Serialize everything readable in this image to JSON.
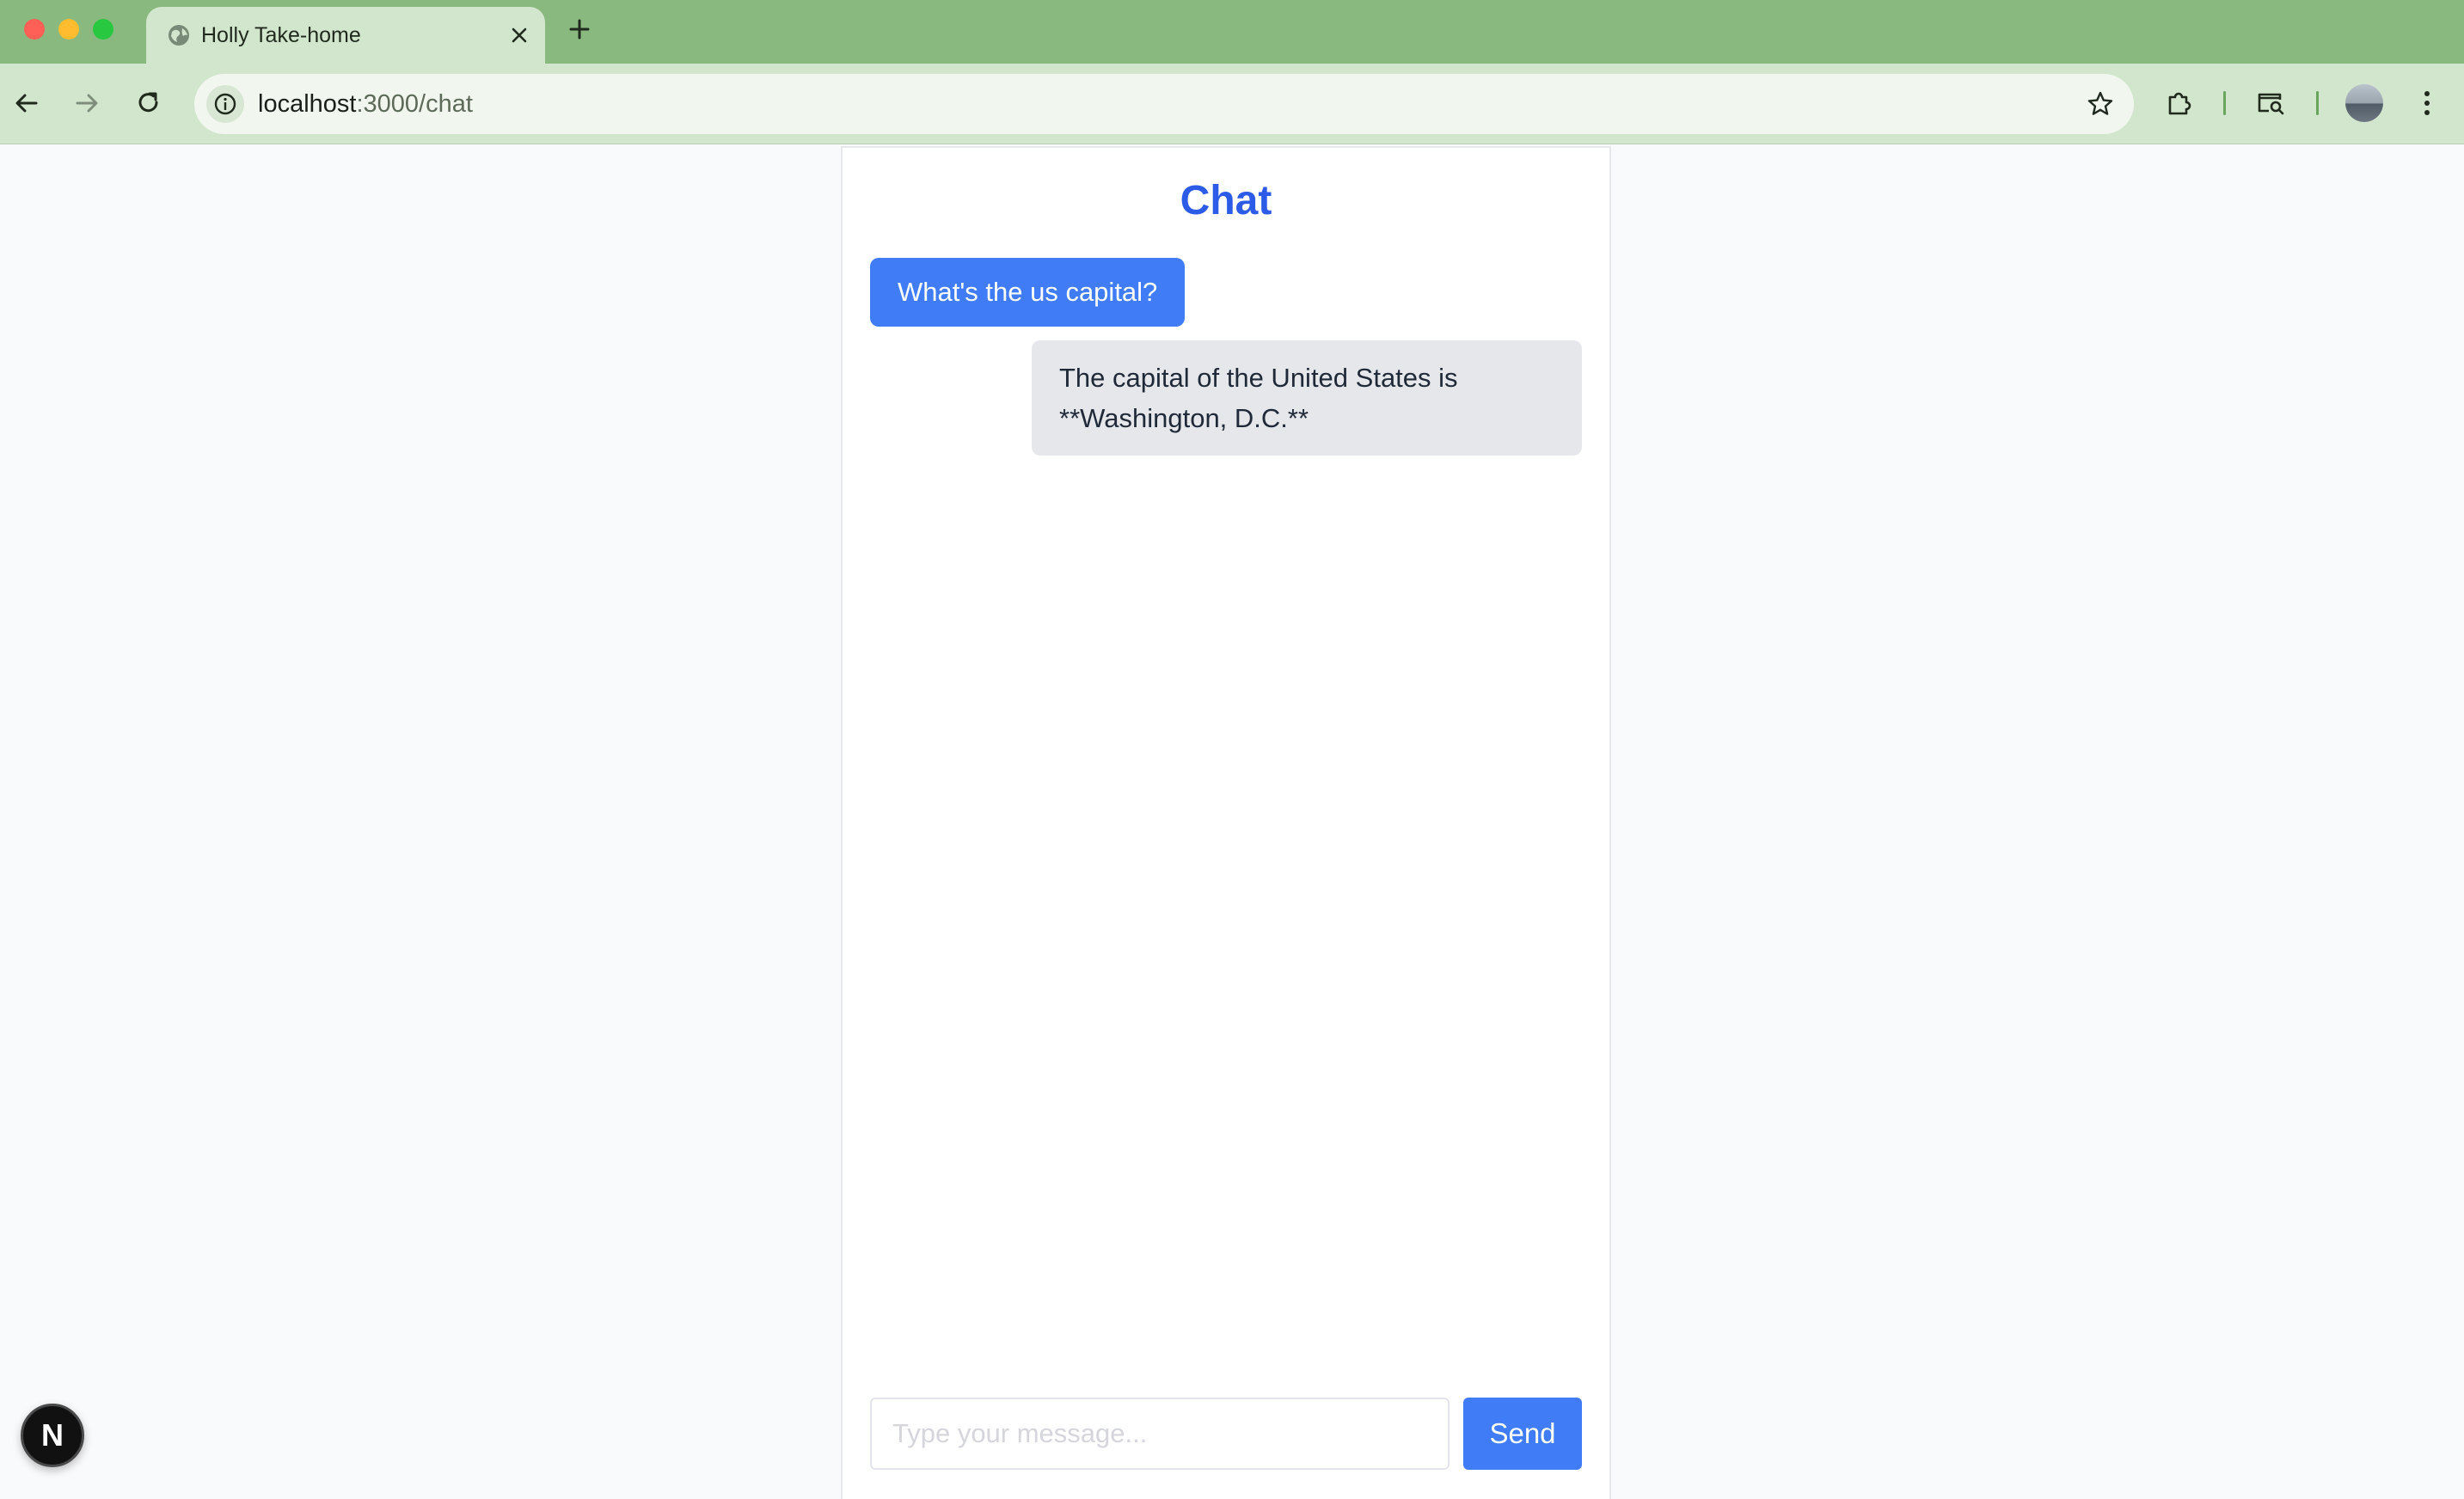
{
  "browser": {
    "tab": {
      "title": "Holly Take-home"
    },
    "address": {
      "host": "localhost",
      "path": ":3000/chat"
    },
    "icons": {
      "favicon": "globe-icon",
      "close": "close-icon",
      "new_tab": "plus-icon",
      "back": "back-arrow-icon",
      "forward": "forward-arrow-icon",
      "reload": "reload-icon",
      "site_info": "info-icon",
      "bookmark": "star-icon",
      "extensions": "puzzle-icon",
      "search_tabs": "tab-search-icon",
      "profile": "avatar",
      "menu": "kebab-menu-icon"
    },
    "colors": {
      "frame": "#8ab97f",
      "toolbar": "#d2e6cd"
    }
  },
  "page": {
    "title": "Chat",
    "messages": [
      {
        "role": "user",
        "text": "What's the us capital?"
      },
      {
        "role": "assistant",
        "text": "The capital of the United States is **Washington, D.C.**"
      }
    ],
    "composer": {
      "placeholder": "Type your message...",
      "value": "",
      "send_label": "Send"
    },
    "dev_badge": {
      "label": "N",
      "icon": "nextjs-logo-icon"
    },
    "colors": {
      "accent": "#3f7cf6",
      "title": "#2c5be8",
      "assistant_bubble": "#e5e7eb"
    }
  }
}
